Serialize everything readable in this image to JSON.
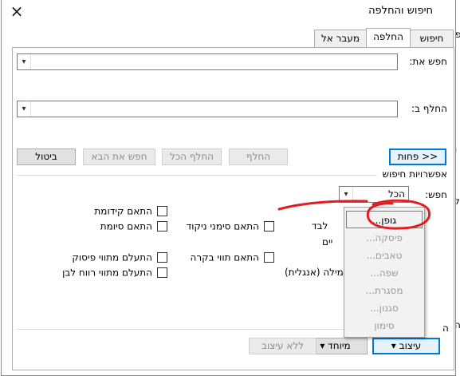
{
  "window": {
    "title": "חיפוש והחלפה",
    "close_symbol": "×"
  },
  "tabs": [
    {
      "label": "חיפוש",
      "active": false
    },
    {
      "label": "החלפה",
      "active": true
    },
    {
      "label": "מעבר אל",
      "active": false
    }
  ],
  "find": {
    "label": "חפש את:",
    "value": ""
  },
  "replace": {
    "label": "החלף ב:",
    "value": ""
  },
  "buttons": {
    "less": "<< פחות",
    "replace": "החלף",
    "replace_all": "החלף הכל",
    "find_next": "חפש את הבא",
    "cancel": "ביטול"
  },
  "options_header": "אפשרויות חיפוש",
  "search": {
    "label": "חפש:",
    "value": "הכל"
  },
  "checkboxes": {
    "match_prefix": "התאם קידומת",
    "match_suffix": "התאם סיומת",
    "match_diacritics": "התאם סימני ניקוד",
    "ignore_punctuation": "התעלם מתווי פיסוק",
    "match_kashida": "התאם תווי בקרה",
    "ignore_whitespace": "התעלם מתווי רווח לבן"
  },
  "partial_texts": {
    "behind_menu_1": "לבד",
    "behind_menu_2": "יים",
    "behind_menu_3": "מילה (אנגלית)",
    "behind_menu_4": "ה"
  },
  "bottom_buttons": {
    "format": "עיצוב",
    "special": "מיוחד",
    "no_formatting": "ללא עיצוב"
  },
  "format_menu": {
    "items": [
      "גופן...",
      "פיסקה...",
      "טאבים...",
      "שפה...",
      "מסגרת...",
      "סגנון...",
      "סימון"
    ],
    "highlighted_index": 0
  },
  "background_chars": [
    "פ",
    "ו",
    "ל",
    "י",
    "ה"
  ],
  "annotation": {
    "color": "#e02020"
  }
}
